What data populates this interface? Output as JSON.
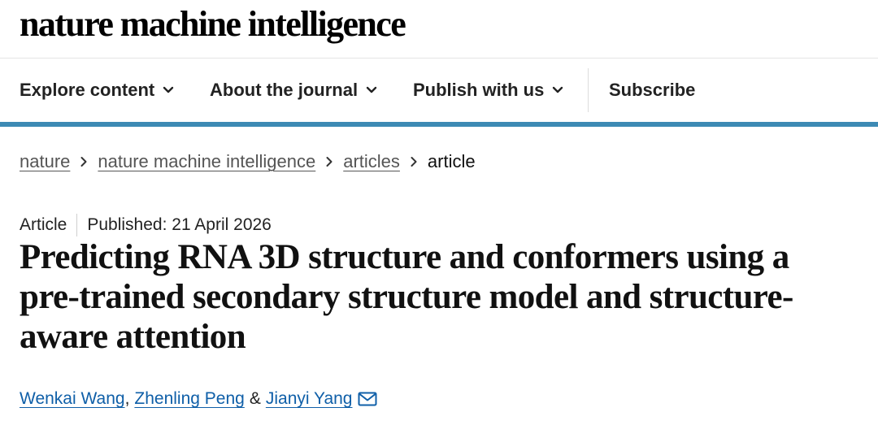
{
  "header": {
    "logo_text": "nature machine intelligence"
  },
  "nav": {
    "items": [
      {
        "label": "Explore content"
      },
      {
        "label": "About the journal"
      },
      {
        "label": "Publish with us"
      }
    ],
    "subscribe_label": "Subscribe",
    "chevron_icon": "chevron-down-icon",
    "accent_color": "#3d8ab4"
  },
  "breadcrumb": {
    "items": [
      "nature",
      "nature machine intelligence",
      "articles"
    ],
    "current": "article",
    "separator_icon": "chevron-right-icon"
  },
  "article": {
    "type": "Article",
    "published": "Published: 21 April 2026",
    "title_lines": [
      "Predicting RNA 3D structure and conformers using a",
      "pre-trained secondary structure model and structure-",
      "aware attention"
    ],
    "authors": [
      "Wenkai Wang",
      "Zhenling Peng",
      "Jianyi Yang"
    ],
    "author_separators": [
      ",",
      "&"
    ],
    "author_link_color": "#0f5fa8",
    "contact_icon": "mail-icon"
  }
}
